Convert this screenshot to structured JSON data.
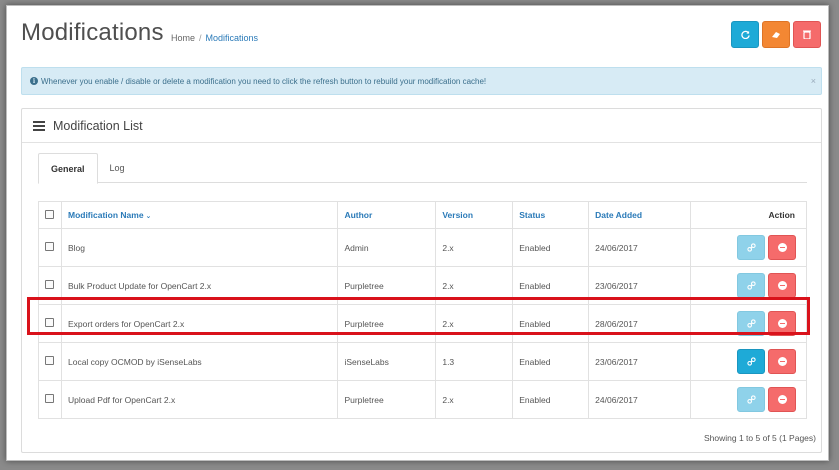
{
  "header": {
    "title": "Modifications",
    "breadcrumb": [
      {
        "label": "Home"
      },
      {
        "label": "Modifications"
      }
    ],
    "buttons": [
      {
        "name": "refresh",
        "icon": "refresh-icon"
      },
      {
        "name": "clear",
        "icon": "eraser-icon"
      },
      {
        "name": "delete",
        "icon": "trash-icon"
      }
    ]
  },
  "alert": {
    "text": "Whenever you enable / disable or delete a modification you need to click the refresh button to rebuild your modification cache!",
    "close": "×"
  },
  "panel": {
    "title": "Modification List",
    "tabs": [
      {
        "label": "General"
      },
      {
        "label": "Log"
      }
    ]
  },
  "table": {
    "headers": {
      "name": "Modification Name",
      "author": "Author",
      "version": "Version",
      "status": "Status",
      "date_added": "Date Added",
      "action": "Action"
    },
    "rows": [
      {
        "name": "Blog",
        "author": "Admin",
        "version": "2.x",
        "status": "Enabled",
        "date_added": "24/06/2017"
      },
      {
        "name": "Bulk Product Update for OpenCart 2.x",
        "author": "Purpletree",
        "version": "2.x",
        "status": "Enabled",
        "date_added": "23/06/2017"
      },
      {
        "name": "Export orders for OpenCart 2.x",
        "author": "Purpletree",
        "version": "2.x",
        "status": "Enabled",
        "date_added": "28/06/2017"
      },
      {
        "name": "Local copy OCMOD by iSenseLabs",
        "author": "iSenseLabs",
        "version": "1.3",
        "status": "Enabled",
        "date_added": "23/06/2017"
      },
      {
        "name": "Upload Pdf for OpenCart 2.x",
        "author": "Purpletree",
        "version": "2.x",
        "status": "Enabled",
        "date_added": "24/06/2017"
      }
    ],
    "pagination": "Showing 1 to 5 of 5 (1 Pages)"
  },
  "colors": {
    "info": "#1eaad7",
    "warning": "#f38733",
    "danger": "#f56b6b",
    "highlight": "#d9121b"
  }
}
